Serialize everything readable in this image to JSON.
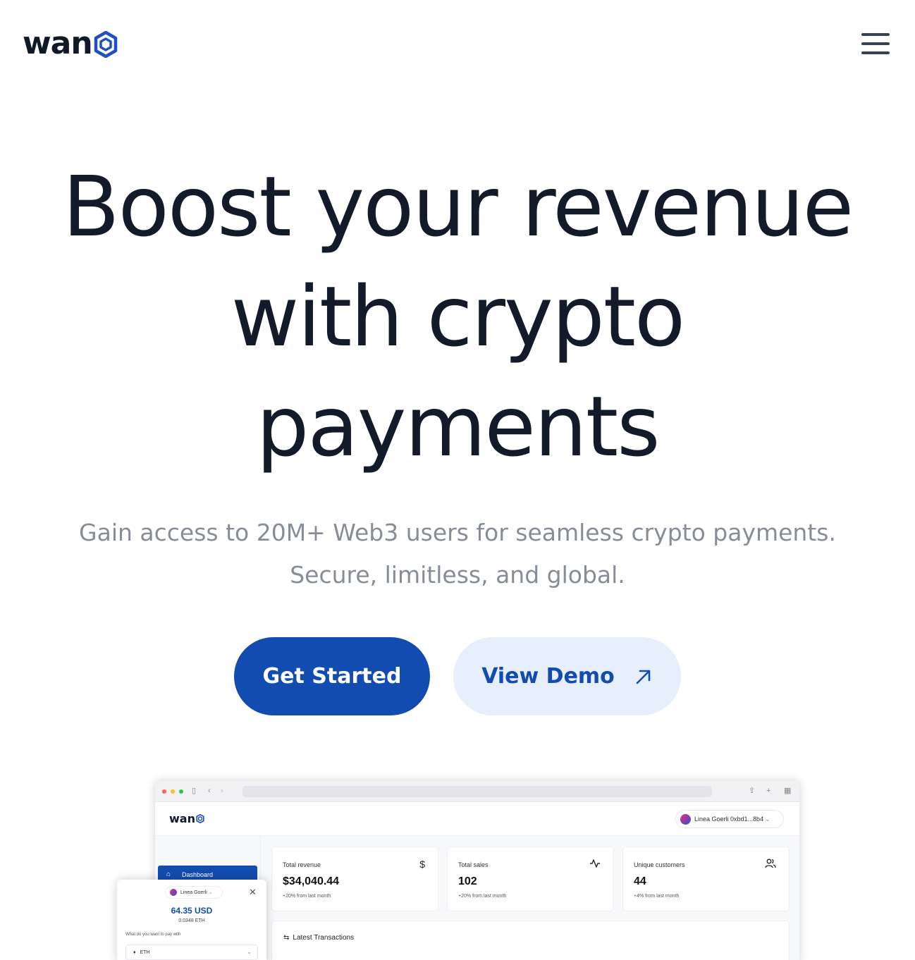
{
  "header": {
    "logo_text": "wan",
    "logo_icon": "hexagon-logo-icon",
    "menu_icon": "hamburger-menu-icon"
  },
  "hero": {
    "title_line1": "Boost your revenue",
    "title_line2": "with crypto",
    "title_line3": "payments",
    "subtitle_line1": "Gain access to 20M+ Web3 users for seamless crypto payments.",
    "subtitle_line2": "Secure, limitless, and global."
  },
  "actions": {
    "primary_label": "Get Started",
    "secondary_label": "View Demo",
    "secondary_icon": "arrow-up-right-icon"
  },
  "colors": {
    "brand": "#134cb0",
    "brand_light": "#e7effc",
    "title": "#131a2a",
    "subtitle": "#878d96"
  },
  "preview": {
    "logo_text": "wan",
    "wallet_label": "Linea Goerli 0xbd1...8b4",
    "sidebar_item": "Dashboard",
    "cards": [
      {
        "label": "Total revenue",
        "value": "$34,040.44",
        "change": "+20% from last month",
        "icon": "$"
      },
      {
        "label": "Total sales",
        "value": "102",
        "change": "+20% from last month",
        "icon": "activity-icon"
      },
      {
        "label": "Unique customers",
        "value": "44",
        "change": "+4% from last month",
        "icon": "users-icon"
      }
    ],
    "transactions_title": "Latest Transactions",
    "popup": {
      "network": "Linea Goerli",
      "amount": "64.35 USD",
      "eth_amount": "0.0348 ETH",
      "question": "What do you want to pay with",
      "selected_token": "ETH"
    }
  }
}
